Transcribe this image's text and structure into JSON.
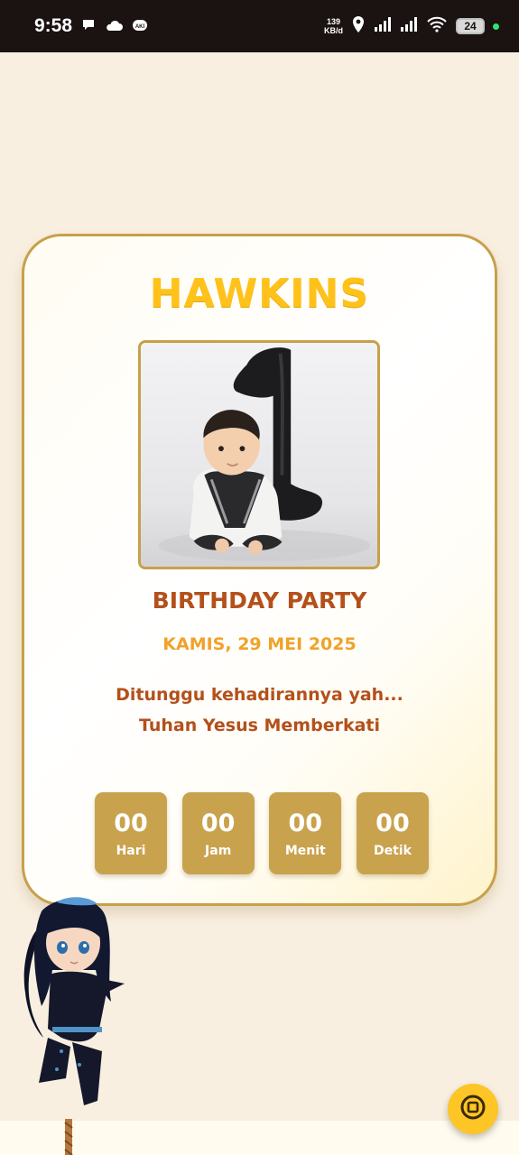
{
  "status_bar": {
    "time": "9:58",
    "speed_value": "139",
    "speed_unit": "KB/d",
    "battery": "24",
    "icons": [
      "chat-icon",
      "cloud-icon",
      "aki-badge-icon",
      "location-icon",
      "signal-icon",
      "signal-icon",
      "wifi-icon",
      "battery-icon"
    ]
  },
  "card": {
    "name": "HAWKINS",
    "event_title": "BIRTHDAY PARTY",
    "event_date": "KAMIS, 29 MEI 2025",
    "message_line1": "Ditunggu kehadirannya yah...",
    "message_line2": "Tuhan Yesus Memberkati"
  },
  "countdown": [
    {
      "value": "00",
      "label": "Hari"
    },
    {
      "value": "00",
      "label": "Jam"
    },
    {
      "value": "00",
      "label": "Menit"
    },
    {
      "value": "00",
      "label": "Detik"
    }
  ],
  "colors": {
    "background": "#f9efe0",
    "card_border": "#c7a049",
    "title": "#ffc21a",
    "event_text": "#b4501a",
    "date_text": "#f0a22a",
    "countdown_box": "#c9a24d",
    "music_button": "#fdc525"
  },
  "music_button": {
    "icon": "music-toggle-icon"
  }
}
